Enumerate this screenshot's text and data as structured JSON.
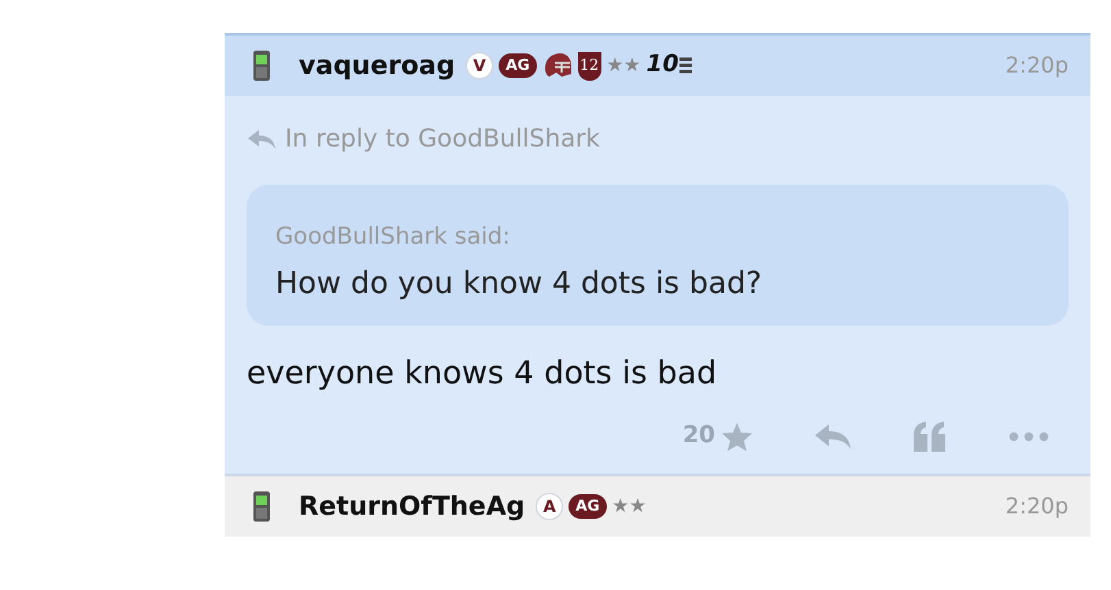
{
  "posts": [
    {
      "author": "vaqueroag",
      "time": "2:20p",
      "badges": [
        {
          "kind": "letter",
          "text": "V"
        },
        {
          "kind": "pill",
          "text": "AG"
        },
        {
          "kind": "helmet"
        },
        {
          "kind": "shield",
          "text": "12"
        },
        {
          "kind": "stars",
          "text": "★★"
        },
        {
          "kind": "rank",
          "text": "10"
        }
      ],
      "reply_to": "In reply to GoodBullShark",
      "quote": {
        "said": "GoodBullShark said:",
        "text": "How do you know 4 dots is bad?"
      },
      "body": "everyone knows 4 dots is bad",
      "like_count": "20"
    },
    {
      "author": "ReturnOfTheAg",
      "time": "2:20p",
      "badges": [
        {
          "kind": "letter",
          "text": "A"
        },
        {
          "kind": "pill",
          "text": "AG"
        },
        {
          "kind": "stars",
          "text": "★★"
        }
      ]
    }
  ]
}
